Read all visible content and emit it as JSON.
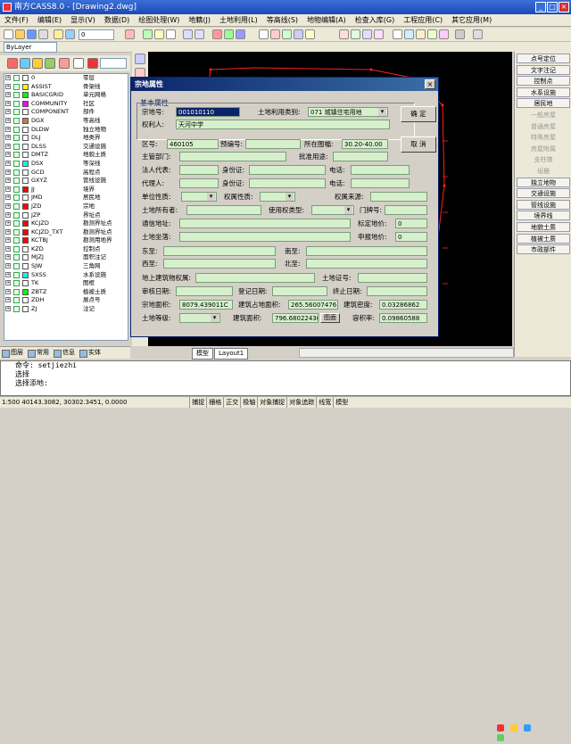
{
  "window": {
    "title": "南方CASS8.0 - [Drawing2.dwg]"
  },
  "menu": [
    "文件(F)",
    "编辑(E)",
    "显示(V)",
    "数据(D)",
    "绘图处理(W)",
    "地籍(J)",
    "土地利用(L)",
    "等高线(S)",
    "地物编辑(A)",
    "检查入库(G)",
    "工程应用(C)",
    "其它应用(M)"
  ],
  "toolbar": {
    "layer_value": "0",
    "linetype_value": "ByLayer"
  },
  "layers": [
    {
      "name": "0",
      "desc": "零层",
      "color": "#ffffff"
    },
    {
      "name": "ASSIST",
      "desc": "骨架线",
      "color": "#ffff00"
    },
    {
      "name": "BASICGRID",
      "desc": "单元网格",
      "color": "#00ff00"
    },
    {
      "name": "COMMUNITY",
      "desc": "社区",
      "color": "#ff00ff"
    },
    {
      "name": "COMPONENT",
      "desc": "部件",
      "color": "#ffffff"
    },
    {
      "name": "DGX",
      "desc": "等高线",
      "color": "#c08040"
    },
    {
      "name": "DLDW",
      "desc": "独立地物",
      "color": "#ffffff"
    },
    {
      "name": "DLJ",
      "desc": "地类界",
      "color": "#ffffff"
    },
    {
      "name": "DLSS",
      "desc": "交通设施",
      "color": "#ffffff"
    },
    {
      "name": "DMTZ",
      "desc": "地貌土质",
      "color": "#ffffff"
    },
    {
      "name": "DSX",
      "desc": "等深线",
      "color": "#00ffff"
    },
    {
      "name": "GCD",
      "desc": "高程点",
      "color": "#ffffff"
    },
    {
      "name": "GXYZ",
      "desc": "管线设施",
      "color": "#ffffff"
    },
    {
      "name": "JJ",
      "desc": "境界",
      "color": "#ff0000"
    },
    {
      "name": "JMD",
      "desc": "居民地",
      "color": "#ffffff"
    },
    {
      "name": "JZD",
      "desc": "宗地",
      "color": "#ff0000"
    },
    {
      "name": "JZP",
      "desc": "界址点",
      "color": "#ffffff"
    },
    {
      "name": "KCJZD",
      "desc": "勘测界址点",
      "color": "#ff0000"
    },
    {
      "name": "KCJZD_TXT",
      "desc": "勘测界址点",
      "color": "#ff0000"
    },
    {
      "name": "KCTBJ",
      "desc": "勘测用地界",
      "color": "#ff0000"
    },
    {
      "name": "KZD",
      "desc": "控制点",
      "color": "#ffffff"
    },
    {
      "name": "MJZJ",
      "desc": "面积注记",
      "color": "#ffffff"
    },
    {
      "name": "SJW",
      "desc": "三角网",
      "color": "#ffffff"
    },
    {
      "name": "SXSS",
      "desc": "水系设施",
      "color": "#00ffff"
    },
    {
      "name": "TK",
      "desc": "图框",
      "color": "#ffffff"
    },
    {
      "name": "ZBTZ",
      "desc": "植被土质",
      "color": "#00ff00"
    },
    {
      "name": "ZDH",
      "desc": "展点号",
      "color": "#ffffff"
    },
    {
      "name": "ZJ",
      "desc": "注记",
      "color": "#ffffff"
    }
  ],
  "right_panel": [
    {
      "label": "点号定位",
      "dim": false
    },
    {
      "label": "文字注记",
      "dim": false
    },
    {
      "label": "控制点",
      "dim": false
    },
    {
      "label": "水系设施",
      "dim": false
    },
    {
      "label": "居民地",
      "dim": false
    },
    {
      "label": "一般房屋",
      "dim": true
    },
    {
      "label": "普通房屋",
      "dim": true
    },
    {
      "label": "特殊房屋",
      "dim": true
    },
    {
      "label": "房屋附属",
      "dim": true
    },
    {
      "label": "支柱墩",
      "dim": true
    },
    {
      "label": "垣栅",
      "dim": true
    },
    {
      "label": "独立地物",
      "dim": false
    },
    {
      "label": "交通设施",
      "dim": false
    },
    {
      "label": "管线设施",
      "dim": false
    },
    {
      "label": "境界线",
      "dim": false
    },
    {
      "label": "地貌土质",
      "dim": false
    },
    {
      "label": "植被土质",
      "dim": false
    },
    {
      "label": "市政部件",
      "dim": false
    }
  ],
  "panel_tabs": [
    "图层",
    "常用",
    "信息",
    "实体"
  ],
  "layout_tabs": [
    "模型",
    "Layout1"
  ],
  "dialog": {
    "title": "宗地属性",
    "section": "基本属性",
    "ok": "确 定",
    "cancel": "取 消",
    "image_button": "图面",
    "labels": {
      "parcel_no": "宗地号:",
      "land_use": "土地利用类别:",
      "owner": "权利人:",
      "district": "区号:",
      "pre_no": "预编号:",
      "map_sheet": "所在图幅:",
      "authority": "主管部门:",
      "approval_use": "批准用途:",
      "legal_rep": "法人代表:",
      "id_card1": "身份证:",
      "phone1": "电话:",
      "agent": "代理人:",
      "id_card2": "身份证:",
      "phone2": "电话:",
      "unit_nature": "单位性质:",
      "right_nature": "权属性质:",
      "right_source": "权属来源:",
      "land_owner": "土地所有者:",
      "use_right_type": "使用权类型:",
      "door_no": "门牌号:",
      "address": "通信地址:",
      "std_price": "标定地价:",
      "location": "土地坐落:",
      "declared_price": "申报地价:",
      "east": "东至:",
      "south": "南至:",
      "west": "西至:",
      "north": "北至:",
      "building_owner": "地上建筑物权属:",
      "cert_no": "土地证号:",
      "review_date": "审核日期:",
      "register_date": "登记日期:",
      "end_date": "终止日期:",
      "area": "宗地面积:",
      "building_footprint": "建筑占地面积:",
      "building_density": "建筑密度:",
      "land_grade": "土地等级:",
      "floor_area": "建筑面积:",
      "plot_ratio": "容积率:"
    },
    "values": {
      "parcel_no": "001010110",
      "land_use": "071 城镇住宅用地",
      "owner": "天河中学",
      "district": "460105",
      "map_sheet": "30.20-40.00",
      "std_price": "0",
      "declared_price": "0",
      "area": "8079.439011C",
      "building_footprint": "265.56007476",
      "building_density": "0.03286862",
      "floor_area": "796.68022436",
      "plot_ratio": "0.09860588"
    }
  },
  "command": {
    "line1": "命令: setjiezhi",
    "line2": "选择",
    "line3": "选择添地:"
  },
  "status": {
    "coords": "1:500  40143.3082, 30302.3451, 0.0000",
    "items": [
      "捕捉",
      "栅格",
      "正交",
      "极轴",
      "对象捕捉",
      "对象追踪",
      "线宽",
      "模型"
    ]
  }
}
